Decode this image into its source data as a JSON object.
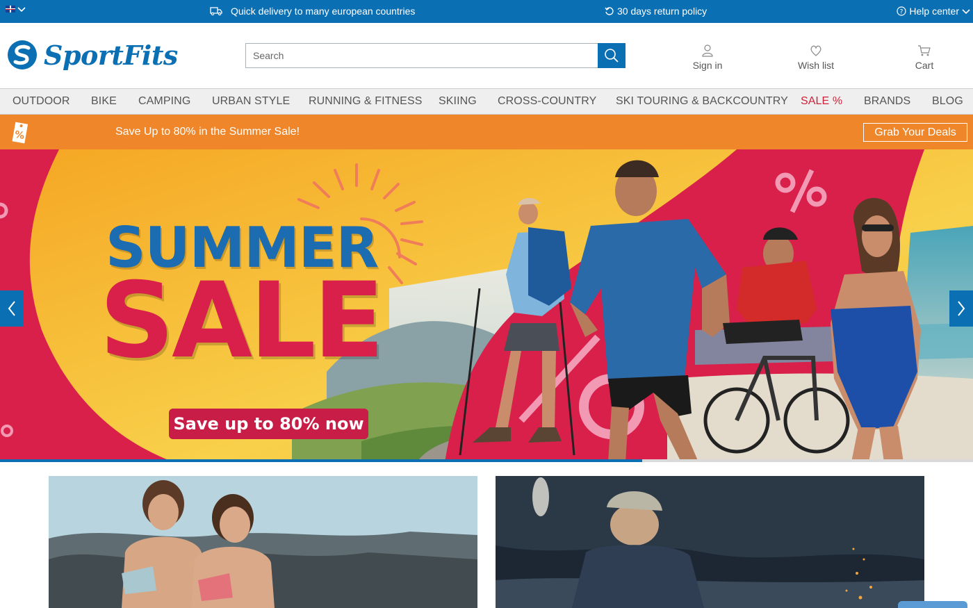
{
  "topbar": {
    "language_icon": "uk-flag-icon",
    "delivery_text": "Quick delivery to many european countries",
    "returns_text": "30 days return policy",
    "help_text": "Help center"
  },
  "header": {
    "logo_text": "SportFits",
    "search_placeholder": "Search",
    "links": {
      "sign_in": "Sign in",
      "wish_list": "Wish list",
      "cart": "Cart"
    }
  },
  "nav": {
    "items": [
      "OUTDOOR",
      "BIKE",
      "CAMPING",
      "URBAN STYLE",
      "RUNNING & FITNESS",
      "SKIING",
      "CROSS-COUNTRY",
      "SKI TOURING & BACKCOUNTRY",
      "SALE %",
      "BRANDS",
      "BLOG"
    ]
  },
  "promo": {
    "text": "Save Up to 80% in the Summer Sale!",
    "cta": "Grab Your Deals",
    "tag_icon": "percent-tag-icon"
  },
  "hero": {
    "headline_1": "SUMMER",
    "headline_2": "SALE",
    "sub": "Save up to 80% now",
    "slider_progress": 0.66
  },
  "colors": {
    "brand_blue": "#0b6fb3",
    "promo_orange": "#f0862a",
    "sale_red": "#d0213a",
    "hero_pink": "#d8204a",
    "hero_yellow": "#f7c437"
  }
}
